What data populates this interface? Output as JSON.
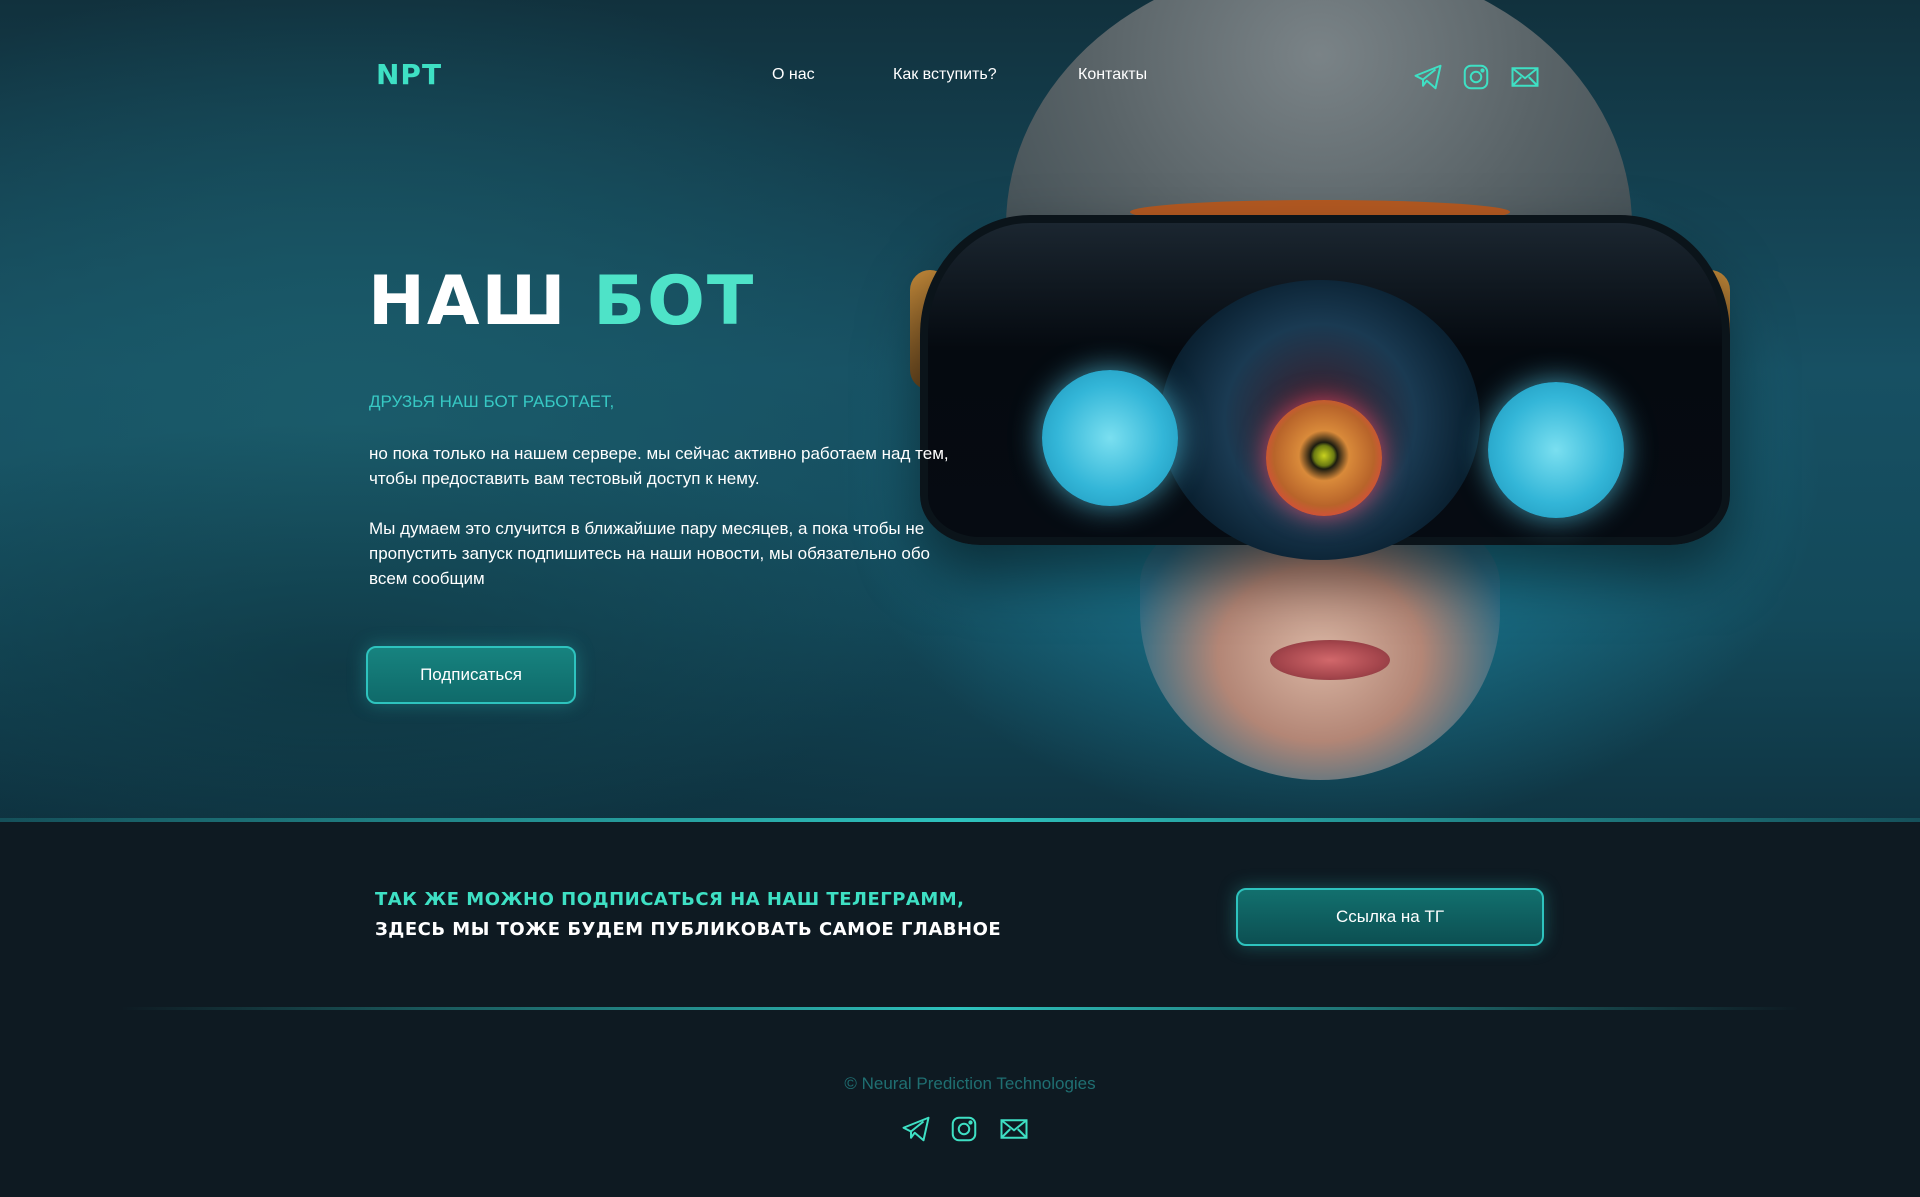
{
  "brand": {
    "logo": "NPT",
    "accent": "#3ee0c4",
    "secondary_accent": "#2ec3be",
    "background": "#0e1a22"
  },
  "nav": {
    "links": [
      "О нас",
      "Как вступить?",
      "Контакты"
    ],
    "social_icons": [
      "telegram-icon",
      "instagram-icon",
      "mail-icon"
    ]
  },
  "hero": {
    "title_white": "НАШ",
    "title_accent": "БОТ",
    "kicker": "ДРУЗЬЯ НАШ БОТ РАБОТАЕТ,",
    "paragraph1": "но пока только на нашем сервере. мы сейчас активно работаем над тем, чтобы предоставить вам тестовый доступ к нему.",
    "paragraph2": "Мы думаем это случится в ближайшие пару месяцев, а пока чтобы не пропустить запуск подпишитесь на наши новости, мы обязательно обо всем сообщим",
    "subscribe_button": "Подписаться"
  },
  "telegram_band": {
    "line1": "ТАК ЖЕ МОЖНО ПОДПИСАТЬСЯ НА НАШ ТЕЛЕГРАММ,",
    "line2": "ЗДЕСЬ МЫ ТОЖЕ БУДЕМ ПУБЛИКОВАТЬ САМОЕ ГЛАВНОЕ",
    "button": "Ссылка на ТГ"
  },
  "footer": {
    "copyright": "© Neural Prediction Technologies",
    "social_icons": [
      "telegram-icon",
      "instagram-icon",
      "mail-icon"
    ]
  }
}
